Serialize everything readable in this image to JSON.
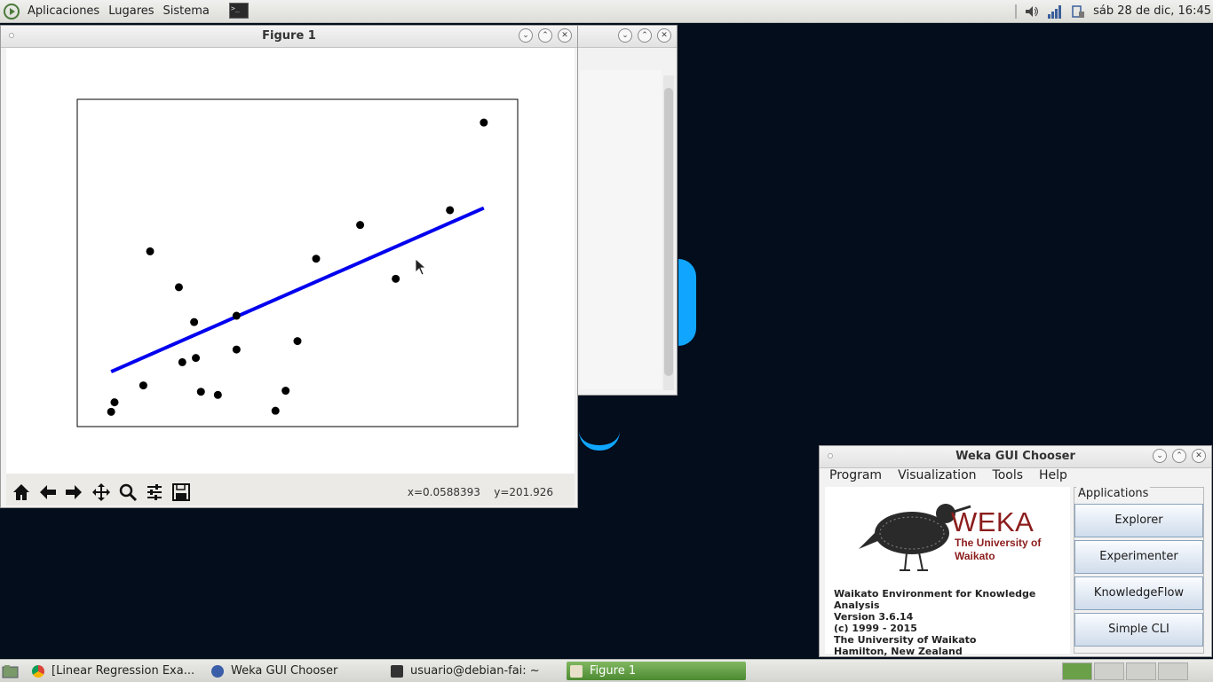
{
  "topbar": {
    "menus": [
      "Aplicaciones",
      "Lugares",
      "Sistema"
    ],
    "clock": "sáb 28 de dic, 16:45"
  },
  "figure_window": {
    "title": "Figure 1",
    "coords_x": "x=0.0588393",
    "coords_y": "y=201.926",
    "toolbar_icons": [
      "home-icon",
      "back-icon",
      "forward-icon",
      "pan-icon",
      "zoom-icon",
      "configure-subplots-icon",
      "save-icon"
    ]
  },
  "chart_data": {
    "type": "scatter",
    "title": "",
    "xlabel": "",
    "ylabel": "",
    "xlim": [
      -0.1,
      0.16
    ],
    "ylim": [
      20,
      330
    ],
    "grid": false,
    "axes_ticks": false,
    "points": [
      {
        "x": -0.08,
        "y": 34
      },
      {
        "x": -0.078,
        "y": 43
      },
      {
        "x": -0.061,
        "y": 59
      },
      {
        "x": -0.057,
        "y": 186
      },
      {
        "x": -0.04,
        "y": 152
      },
      {
        "x": -0.038,
        "y": 81
      },
      {
        "x": -0.031,
        "y": 119
      },
      {
        "x": -0.03,
        "y": 85
      },
      {
        "x": -0.027,
        "y": 53
      },
      {
        "x": -0.017,
        "y": 50
      },
      {
        "x": -0.006,
        "y": 125
      },
      {
        "x": -0.006,
        "y": 93
      },
      {
        "x": 0.017,
        "y": 35
      },
      {
        "x": 0.023,
        "y": 54
      },
      {
        "x": 0.03,
        "y": 101
      },
      {
        "x": 0.041,
        "y": 179
      },
      {
        "x": 0.067,
        "y": 211
      },
      {
        "x": 0.088,
        "y": 160
      },
      {
        "x": 0.12,
        "y": 225
      },
      {
        "x": 0.14,
        "y": 308
      }
    ],
    "line": {
      "x": [
        -0.08,
        0.14
      ],
      "y": [
        72,
        227
      ]
    },
    "colors": {
      "points": "#000000",
      "line": "#0000ee"
    }
  },
  "bg_window": {
    "title": ""
  },
  "weka": {
    "title": "Weka GUI Chooser",
    "menus": [
      "Program",
      "Visualization",
      "Tools",
      "Help"
    ],
    "logo_text": "WEKA",
    "logo_uni": "The University of Waikato",
    "info": [
      "Waikato Environment for Knowledge Analysis",
      "Version 3.6.14",
      "(c) 1999 - 2015",
      "The University of Waikato",
      "Hamilton, New Zealand"
    ],
    "applications_label": "Applications",
    "buttons": [
      "Explorer",
      "Experimenter",
      "KnowledgeFlow",
      "Simple CLI"
    ]
  },
  "taskbar": {
    "tasks": [
      "[Linear Regression Exa...",
      "Weka GUI Chooser",
      "usuario@debian-fai: ~",
      "Figure 1"
    ],
    "active_task": "Figure 1"
  }
}
